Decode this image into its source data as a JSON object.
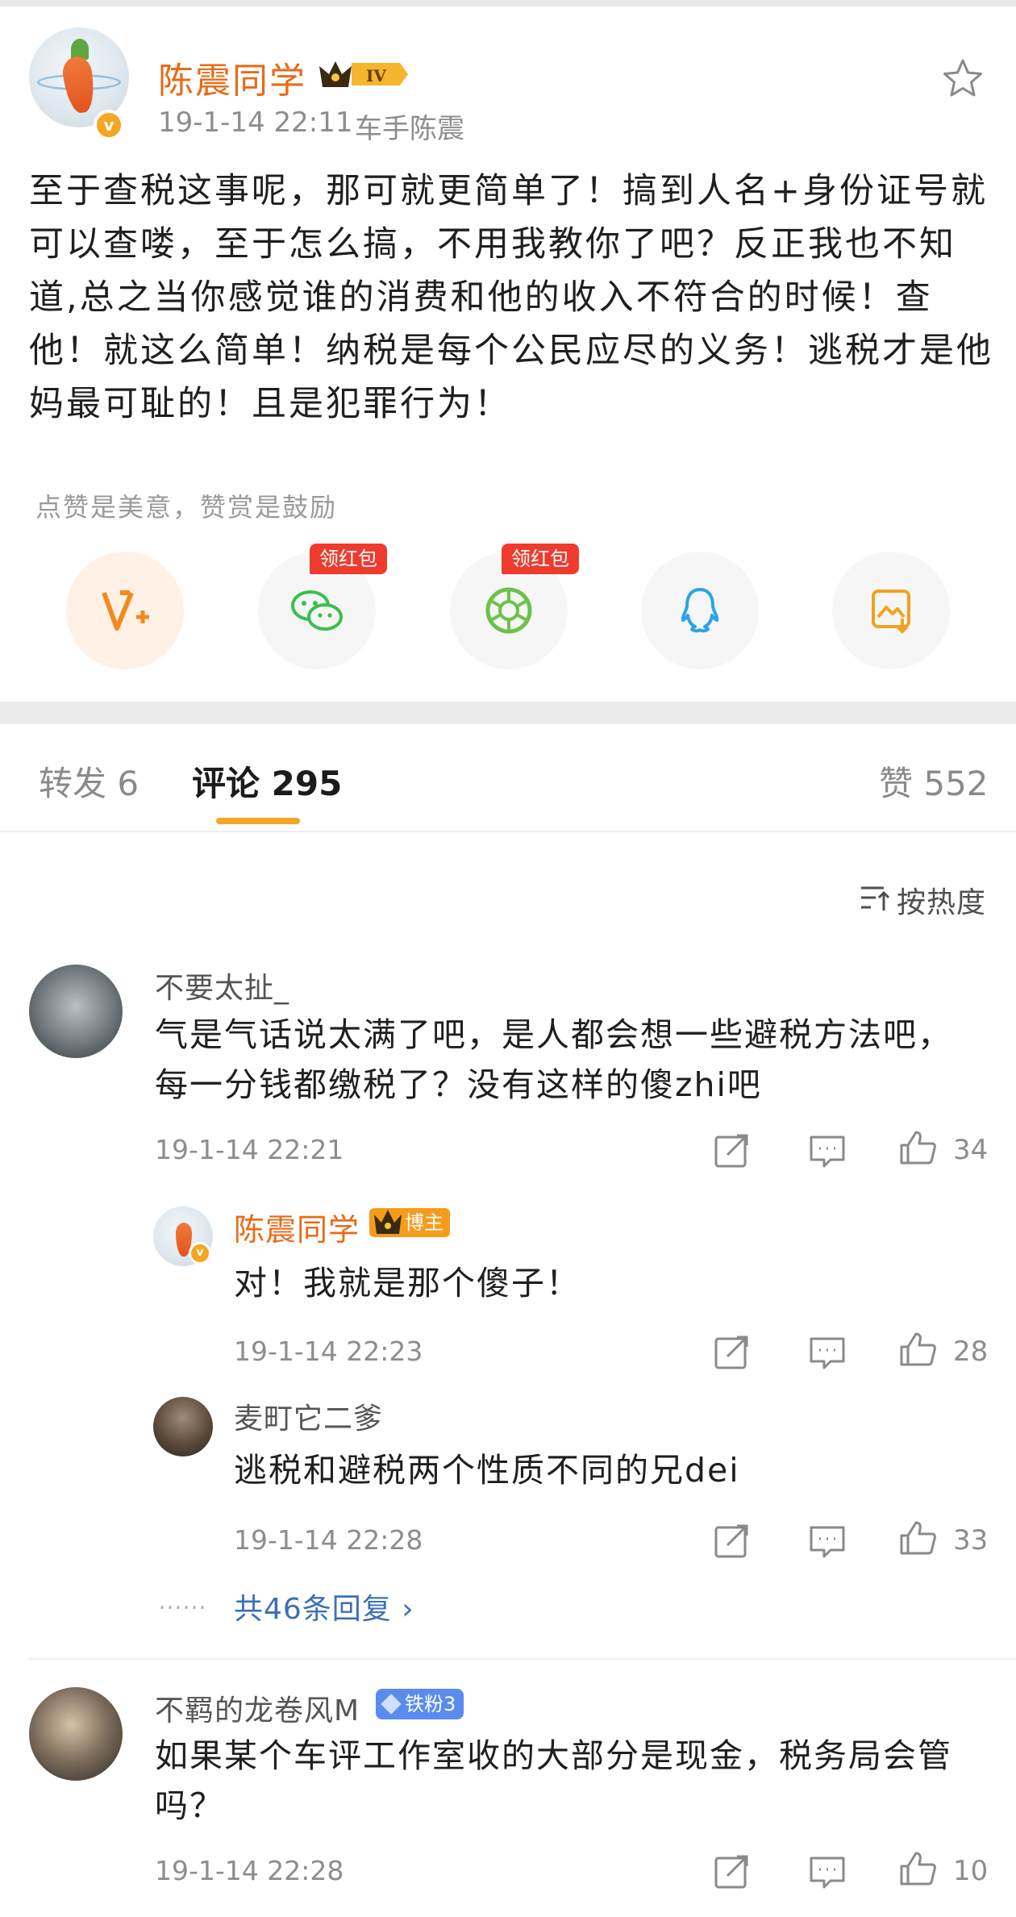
{
  "post": {
    "author_name": "陈震同学",
    "level_badge": "IV",
    "timestamp": "19-1-14 22:11",
    "source": "车手陈震",
    "text": "至于查税这事呢，那可就更简单了！搞到人名+身份证号就可以查喽，至于怎么搞，不用我教你了吧？反正我也不知道,总之当你感觉谁的消费和他的收入不符合的时候！查他！就这么简单！纳税是每个公民应尽的义务！逃税才是他妈最可耻的！且是犯罪行为！",
    "reward_hint": "点赞是美意，赞赏是鼓励",
    "share_targets": [
      {
        "icon": "v-plus-icon"
      },
      {
        "icon": "wechat-icon",
        "tag": "领红包"
      },
      {
        "icon": "moments-icon",
        "tag": "领红包"
      },
      {
        "icon": "qq-icon"
      },
      {
        "icon": "save-image-icon"
      }
    ]
  },
  "tabs": {
    "repost": "转发 6",
    "comments_label": "评论",
    "comments_count": "295",
    "likes": "赞 552"
  },
  "sort_label": "按热度",
  "comments": [
    {
      "user": "不要太扯_",
      "text": "气是气话说太满了吧，是人都会想一些避税方法吧，每一分钱都缴税了？没有这样的傻zhi吧",
      "time": "19-1-14 22:21",
      "likes": "34",
      "replies": [
        {
          "user": "陈震同学",
          "badge": "博主",
          "text": "对！我就是那个傻子！",
          "time": "19-1-14 22:23",
          "likes": "28"
        },
        {
          "user": "麦町它二爹",
          "text": "逃税和避税两个性质不同的兄dei",
          "time": "19-1-14 22:28",
          "likes": "33"
        }
      ],
      "more_replies": "共46条回复 ›"
    },
    {
      "user": "不羁的龙卷风M",
      "badge": "铁粉3",
      "text": "如果某个车评工作室收的大部分是现金，税务局会管吗？",
      "time": "19-1-14 22:28",
      "likes": "10"
    }
  ],
  "colors": {
    "accent": "#f5a623",
    "author": "#e86b17",
    "link": "#3d6fb5",
    "redpack": "#ef3b2d",
    "fan": "#5a8bef"
  }
}
